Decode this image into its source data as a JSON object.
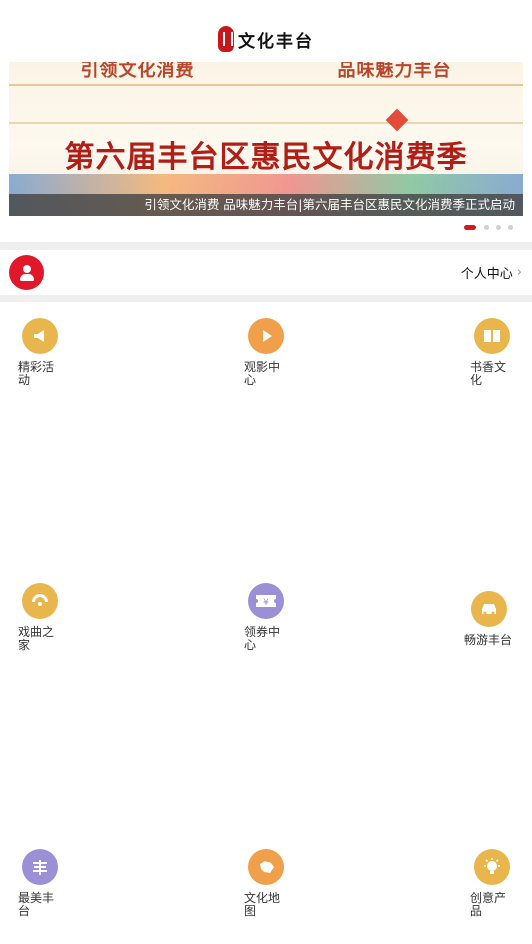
{
  "header": {
    "logo_text": "文化丰台"
  },
  "banner": {
    "top_left": "引领文化消费",
    "top_right": "品味魅力丰台",
    "headline": "第六届丰台区惠民文化消费季",
    "caption": "引领文化消费 品味魅力丰台|第六届丰台区惠民文化消费季正式启动",
    "slide_count": 4,
    "active_slide": 1
  },
  "profile": {
    "label": "个人中心",
    "chevron": "›"
  },
  "grid": [
    {
      "label": "精彩活动",
      "icon": "megaphone-icon",
      "color": "#e8b64c"
    },
    {
      "label": "观影中心",
      "icon": "play-icon",
      "color": "#f0a04b"
    },
    {
      "label": "书香文化",
      "icon": "book-icon",
      "color": "#e8b64c"
    },
    {
      "label": "戏曲之家",
      "icon": "opera-fan-icon",
      "color": "#e8b64c"
    },
    {
      "label": "领券中心",
      "icon": "coupon-icon",
      "color": "#9b8fd6"
    },
    {
      "label": "畅游丰台",
      "icon": "car-icon",
      "color": "#e8b64c"
    },
    {
      "label": "最美丰台",
      "icon": "feng-icon",
      "color": "#9b8fd6"
    },
    {
      "label": "文化地图",
      "icon": "map-icon",
      "color": "#f0a04b"
    },
    {
      "label": "创意产品",
      "icon": "lightbulb-icon",
      "color": "#e8b64c"
    }
  ],
  "icon_glyphs": {
    "megaphone": "◀",
    "play": "▶",
    "book": "▯▯",
    "opera_fan": "◠",
    "coupon": "¥",
    "car": "▣",
    "feng": "丰",
    "map": "◆",
    "lightbulb": "✺"
  }
}
